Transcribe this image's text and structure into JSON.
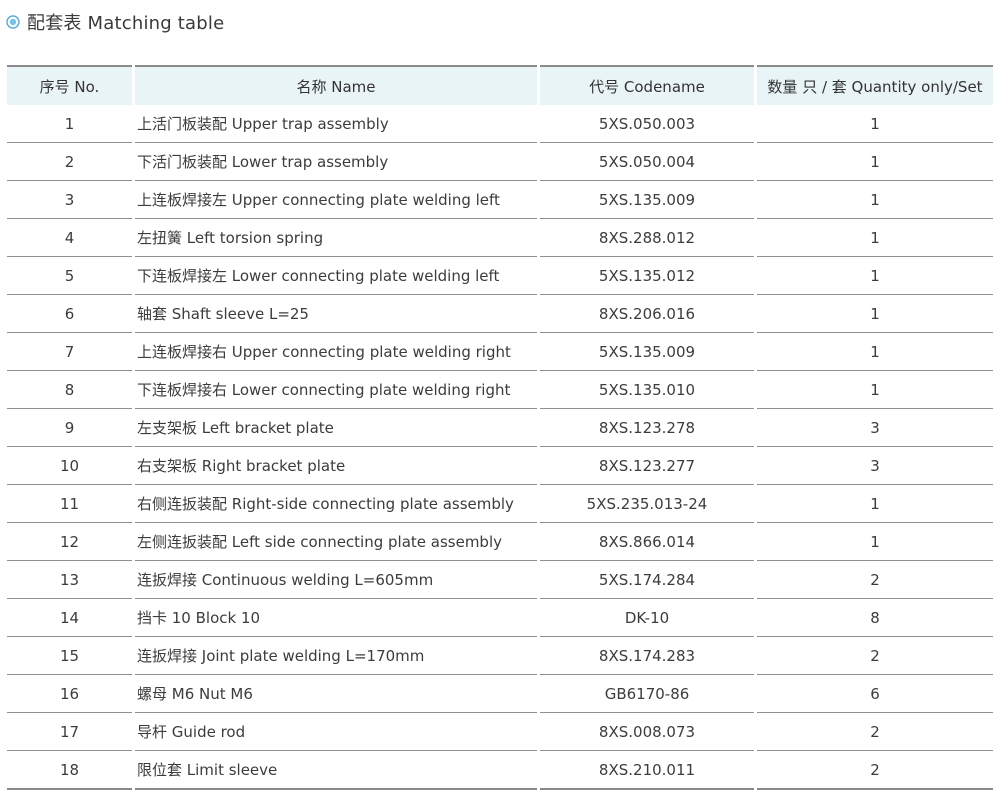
{
  "header": {
    "title": "配套表 Matching table",
    "icon": "circle-bullet-icon",
    "accent_color": "#5aa9d6"
  },
  "table": {
    "columns": [
      "序号 No.",
      "名称 Name",
      "代号 Codename",
      "数量 只 / 套 Quantity only/Set"
    ],
    "rows": [
      {
        "no": "1",
        "name": "上活门板装配 Upper trap assembly",
        "code": "5XS.050.003",
        "qty": "1"
      },
      {
        "no": "2",
        "name": "下活门板装配 Lower trap assembly",
        "code": "5XS.050.004",
        "qty": "1"
      },
      {
        "no": "3",
        "name": "上连板焊接左 Upper connecting plate welding left",
        "code": "5XS.135.009",
        "qty": "1"
      },
      {
        "no": "4",
        "name": "左扭簧 Left torsion spring",
        "code": "8XS.288.012",
        "qty": "1"
      },
      {
        "no": "5",
        "name": "下连板焊接左 Lower connecting plate welding left",
        "code": "5XS.135.012",
        "qty": "1"
      },
      {
        "no": "6",
        "name": "轴套 Shaft sleeve L=25",
        "code": "8XS.206.016",
        "qty": "1"
      },
      {
        "no": "7",
        "name": "上连板焊接右 Upper connecting plate welding right",
        "code": "5XS.135.009",
        "qty": "1"
      },
      {
        "no": "8",
        "name": "下连板焊接右 Lower connecting plate welding right",
        "code": "5XS.135.010",
        "qty": "1"
      },
      {
        "no": "9",
        "name": "左支架板 Left bracket plate",
        "code": "8XS.123.278",
        "qty": "3"
      },
      {
        "no": "10",
        "name": "右支架板 Right bracket plate",
        "code": "8XS.123.277",
        "qty": "3"
      },
      {
        "no": "11",
        "name": "右侧连扳装配 Right-side connecting plate assembly",
        "code": "5XS.235.013-24",
        "qty": "1"
      },
      {
        "no": "12",
        "name": "左侧连扳装配 Left side connecting plate assembly",
        "code": "8XS.866.014",
        "qty": "1"
      },
      {
        "no": "13",
        "name": "连扳焊接 Continuous welding  L=605mm",
        "code": "5XS.174.284",
        "qty": "2"
      },
      {
        "no": "14",
        "name": "挡卡 10 Block 10",
        "code": "DK-10",
        "qty": "8"
      },
      {
        "no": "15",
        "name": "连扳焊接 Joint plate welding   L=170mm",
        "code": "8XS.174.283",
        "qty": "2"
      },
      {
        "no": "16",
        "name": "螺母 M6 Nut M6",
        "code": "GB6170-86",
        "qty": "6"
      },
      {
        "no": "17",
        "name": "导杆 Guide rod",
        "code": "8XS.008.073",
        "qty": "2"
      },
      {
        "no": "18",
        "name": "限位套 Limit sleeve",
        "code": "8XS.210.011",
        "qty": "2"
      }
    ]
  }
}
